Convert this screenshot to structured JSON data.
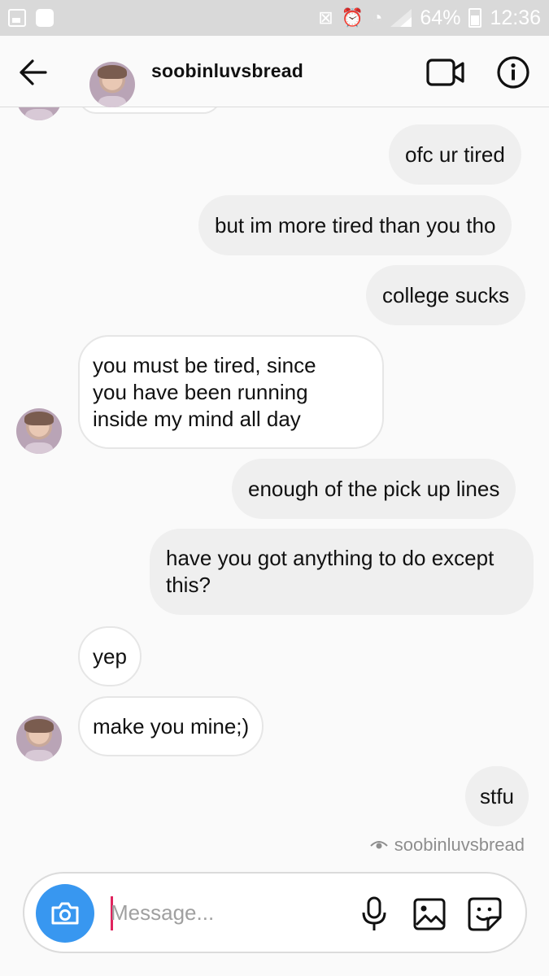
{
  "status_bar": {
    "battery": "64%",
    "time": "12:36"
  },
  "header": {
    "username": "soobinluvsbread",
    "back_icon": "arrow-left-icon",
    "video_icon": "video-camera-icon",
    "info_icon": "info-icon"
  },
  "messages": [
    {
      "side": "out",
      "text": "ofc ur tired"
    },
    {
      "side": "out",
      "text": "but im more tired than you tho"
    },
    {
      "side": "out",
      "text": "college sucks"
    },
    {
      "side": "in",
      "lines": [
        "you must be tired, since",
        "you have been running",
        "inside my mind all day"
      ]
    },
    {
      "side": "out",
      "text": "enough of the pick up lines"
    },
    {
      "side": "out",
      "lines": [
        "have you got anything to do except",
        "this?"
      ]
    },
    {
      "side": "in",
      "text": "yep"
    },
    {
      "side": "in",
      "text": "make you mine;)"
    },
    {
      "side": "out",
      "text": "stfu"
    }
  ],
  "seen": {
    "username": "soobinluvsbread"
  },
  "composer": {
    "placeholder": "Message..."
  },
  "colors": {
    "accent": "#3897f0",
    "cursor": "#e0245e",
    "bubble_out": "#efefef",
    "bubble_in": "#ffffff"
  }
}
